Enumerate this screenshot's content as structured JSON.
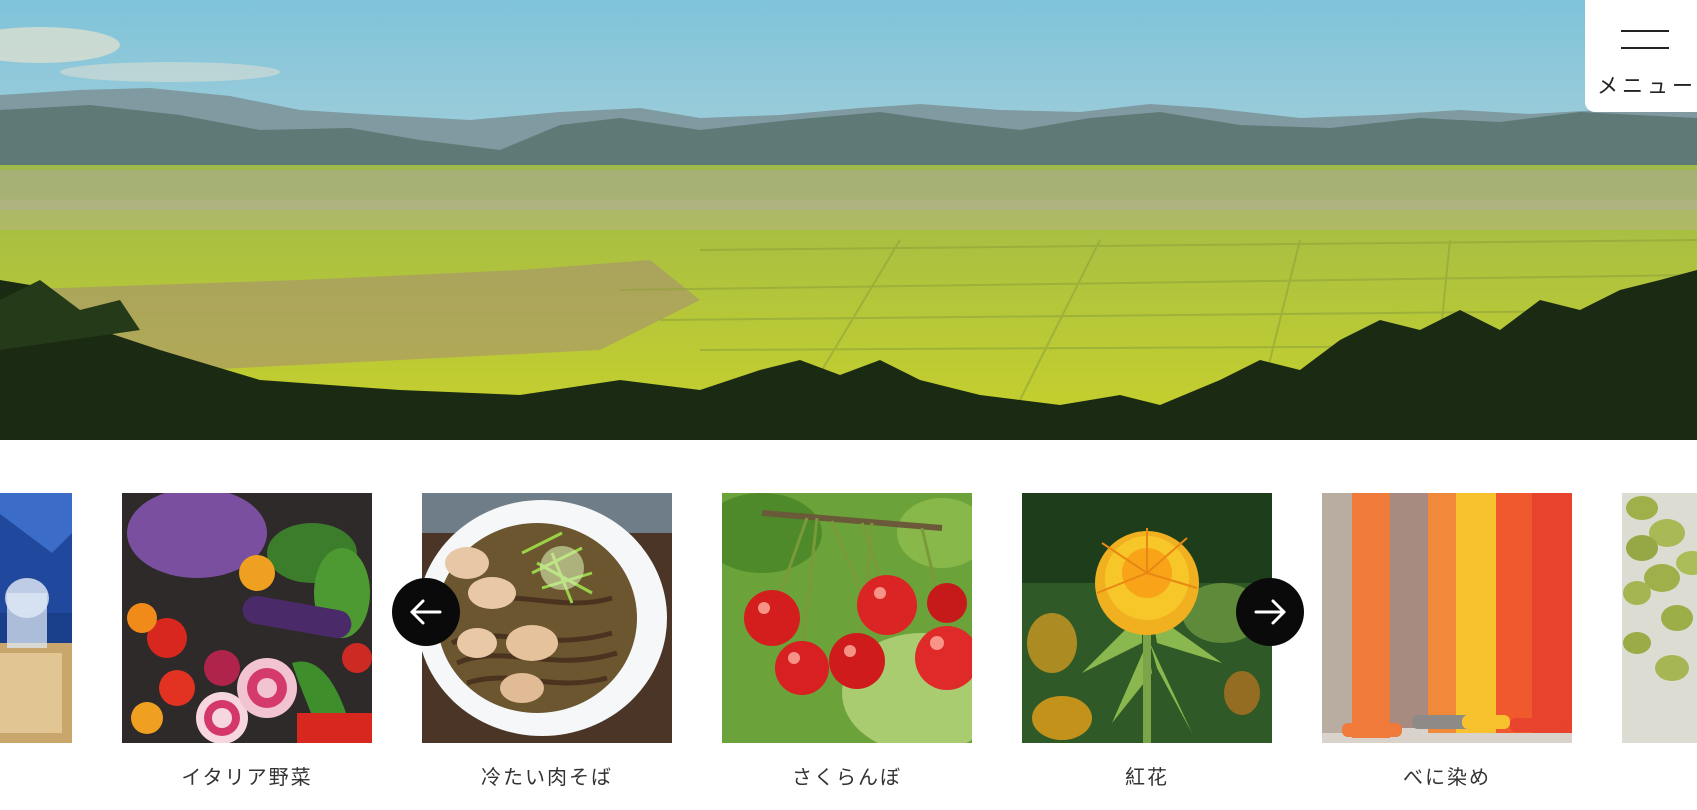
{
  "menu": {
    "label": "メニュー",
    "icon": "hamburger-icon"
  },
  "hero": {
    "image": "landscape-photo"
  },
  "carousel": {
    "prev_icon": "arrow-left-icon",
    "next_icon": "arrow-right-icon",
    "slides": [
      {
        "label": "",
        "image": "sake-photo"
      },
      {
        "label": "イタリア野菜",
        "image": "vegetables-photo"
      },
      {
        "label": "冷たい肉そば",
        "image": "soba-photo"
      },
      {
        "label": "さくらんぼ",
        "image": "cherries-photo"
      },
      {
        "label": "紅花",
        "image": "safflower-photo"
      },
      {
        "label": "べに染め",
        "image": "dyed-fabric-photo"
      },
      {
        "label": "",
        "image": "edamame-photo"
      }
    ]
  }
}
